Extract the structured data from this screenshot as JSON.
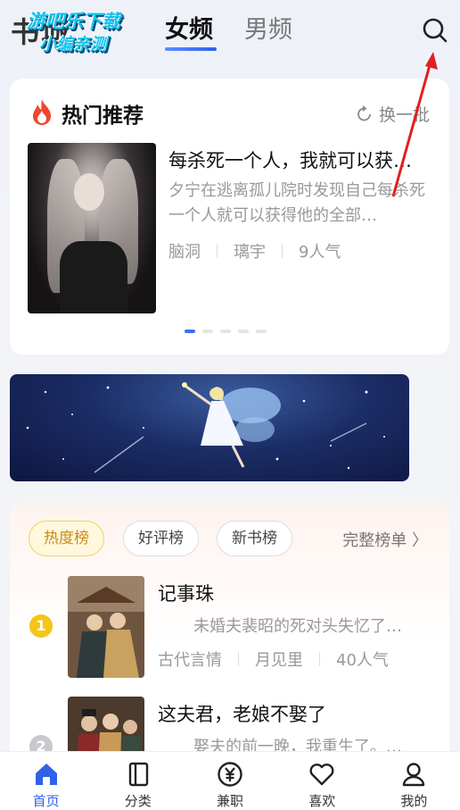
{
  "header": {
    "watermark_line1": "游吧乐下载",
    "watermark_line2": "小编亲测",
    "watermark_bg": "书城",
    "tabs": [
      {
        "label": "女频",
        "active": true
      },
      {
        "label": "男频",
        "active": false
      }
    ],
    "search_icon": "search-icon"
  },
  "hot": {
    "title": "热门推荐",
    "refresh_label": "换一批",
    "book": {
      "title": "每杀死一个人，我就可以获…",
      "desc": "夕宁在逃离孤儿院时发现自己每杀死一个人就可以获得他的全部…",
      "tags": [
        "脑洞",
        "璃宇",
        "9人气"
      ]
    },
    "page_count": 5,
    "active_page": 0
  },
  "ranking": {
    "chips": [
      {
        "label": "热度榜",
        "active": true
      },
      {
        "label": "好评榜",
        "active": false
      },
      {
        "label": "新书榜",
        "active": false
      }
    ],
    "full_list_label": "完整榜单 〉",
    "items": [
      {
        "rank": "1",
        "title": "记事珠",
        "desc": "未婚夫裴昭的死对头失忆了…",
        "tags": [
          "古代言情",
          "月见里",
          "40人气"
        ],
        "badge_color": "#f5c518"
      },
      {
        "rank": "2",
        "title": "这夫君，老娘不娶了",
        "desc": "娶夫的前一晚，我重生了。…",
        "tags": [],
        "badge_color": "#c7c9cf"
      }
    ]
  },
  "bottom_nav": [
    {
      "label": "首页",
      "icon": "home-icon",
      "active": true
    },
    {
      "label": "分类",
      "icon": "category-icon",
      "active": false
    },
    {
      "label": "兼职",
      "icon": "yuan-icon",
      "active": false
    },
    {
      "label": "喜欢",
      "icon": "heart-icon",
      "active": false
    },
    {
      "label": "我的",
      "icon": "user-icon",
      "active": false
    }
  ],
  "colors": {
    "accent": "#2f62e8",
    "annotation": "#e02020",
    "rank_gold": "#f5c518"
  }
}
